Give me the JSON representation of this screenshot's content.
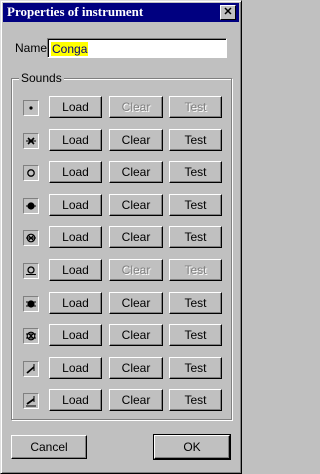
{
  "window": {
    "title": "Properties of instrument",
    "close_glyph": "✕"
  },
  "name": {
    "label": "Name",
    "value": "Conga"
  },
  "sounds": {
    "label": "Sounds",
    "rows": [
      {
        "icon": "dot-note-icon",
        "load": "Load",
        "clear": "Clear",
        "test": "Test",
        "clear_enabled": false,
        "test_enabled": false
      },
      {
        "icon": "x-note-icon",
        "load": "Load",
        "clear": "Clear",
        "test": "Test",
        "clear_enabled": true,
        "test_enabled": true
      },
      {
        "icon": "open-circle-note-icon",
        "load": "Load",
        "clear": "Clear",
        "test": "Test",
        "clear_enabled": true,
        "test_enabled": true
      },
      {
        "icon": "filled-circle-note-icon",
        "load": "Load",
        "clear": "Clear",
        "test": "Test",
        "clear_enabled": true,
        "test_enabled": true
      },
      {
        "icon": "boxed-x-note-icon",
        "load": "Load",
        "clear": "Clear",
        "test": "Test",
        "clear_enabled": true,
        "test_enabled": true
      },
      {
        "icon": "underlined-circle-note-icon",
        "load": "Load",
        "clear": "Clear",
        "test": "Test",
        "clear_enabled": false,
        "test_enabled": false
      },
      {
        "icon": "filled-circle-ledger-note-icon",
        "load": "Load",
        "clear": "Clear",
        "test": "Test",
        "clear_enabled": true,
        "test_enabled": true
      },
      {
        "icon": "boxed-x-ledger-note-icon",
        "load": "Load",
        "clear": "Clear",
        "test": "Test",
        "clear_enabled": true,
        "test_enabled": true
      },
      {
        "icon": "slash-note-icon",
        "load": "Load",
        "clear": "Clear",
        "test": "Test",
        "clear_enabled": true,
        "test_enabled": true
      },
      {
        "icon": "slash-ledger-note-icon",
        "load": "Load",
        "clear": "Clear",
        "test": "Test",
        "clear_enabled": true,
        "test_enabled": true
      }
    ]
  },
  "footer": {
    "cancel": "Cancel",
    "ok": "OK"
  }
}
